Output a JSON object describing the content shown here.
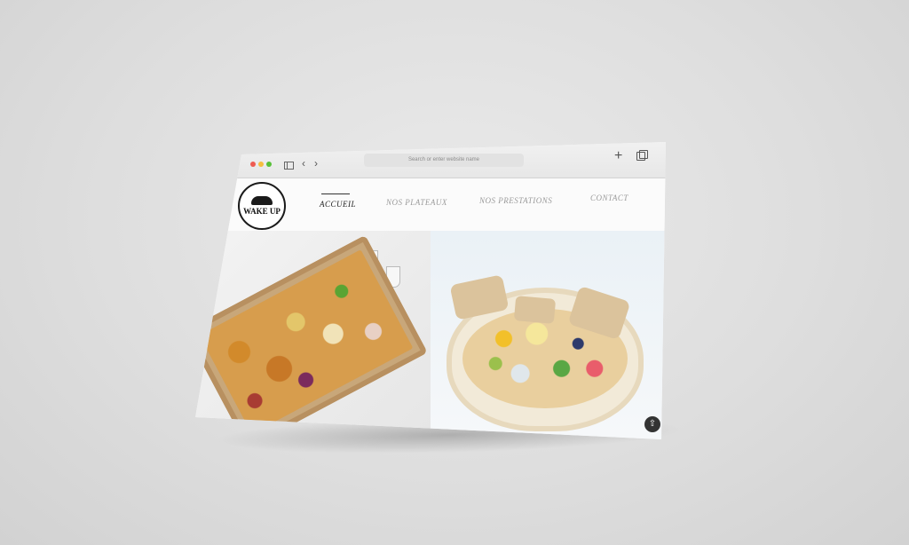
{
  "browser": {
    "url_placeholder": "Search or enter website name",
    "new_tab_icon": "+",
    "back_icon": "‹",
    "forward_icon": "›"
  },
  "site": {
    "logo_text": "WAKE UP",
    "nav": [
      {
        "label": "ACCUEIL",
        "active": true
      },
      {
        "label": "NOS PLATEAUX",
        "active": false
      },
      {
        "label": "NOS PRESTATIONS",
        "active": false
      },
      {
        "label": "CONTACT",
        "active": false
      }
    ]
  },
  "hero": {
    "images": [
      "breakfast-box-photo",
      "grazing-bowl-photo"
    ],
    "scroll_top_icon": "⇧"
  },
  "colors": {
    "accent": "#222222",
    "nav_inactive": "#9a9a9a",
    "background": "#dedede"
  }
}
